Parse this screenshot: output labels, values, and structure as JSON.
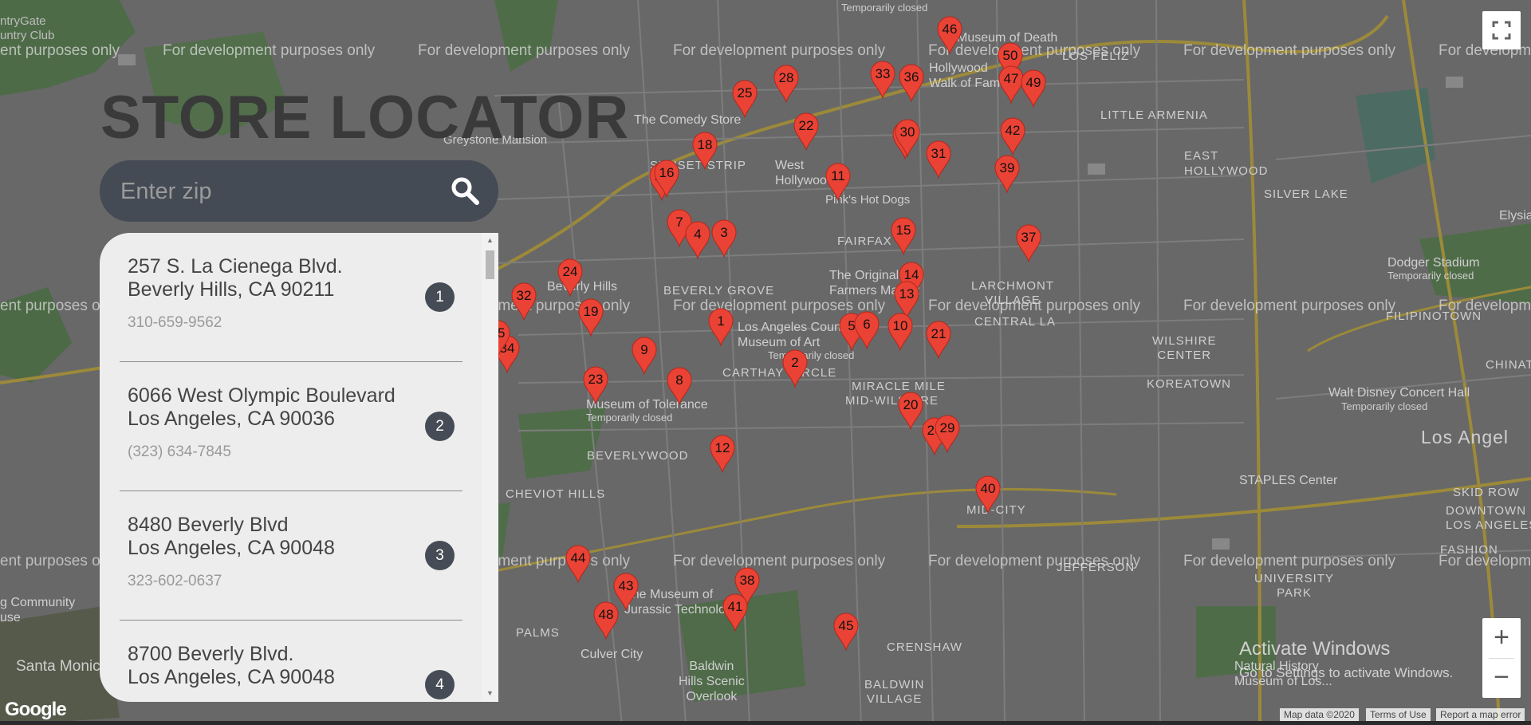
{
  "watermark": "For development purposes only",
  "watermark_prefix": "ent purposes only",
  "watermark_suffix": "For developm",
  "title": "STORE LOCATOR",
  "search": {
    "placeholder": "Enter zip",
    "icon": "search-icon"
  },
  "stores": [
    {
      "line1": "257 S. La Cienega Blvd.",
      "line2": "Beverly Hills, CA 90211",
      "phone": "310-659-9562",
      "number": "1"
    },
    {
      "line1": "6066 West Olympic Boulevard",
      "line2": "Los Angeles, CA 90036",
      "phone": "(323) 634-7845",
      "number": "2"
    },
    {
      "line1": "8480 Beverly Blvd",
      "line2": "Los Angeles, CA 90048",
      "phone": "323-602-0637",
      "number": "3"
    },
    {
      "line1": "8700 Beverly Blvd.",
      "line2": "Los Angeles, CA 90048",
      "phone": "",
      "number": "4"
    }
  ],
  "markers": [
    "46",
    "50",
    "47",
    "49",
    "33",
    "36",
    "25",
    "28",
    "22",
    "18",
    "27",
    "31",
    "42",
    "39",
    "17",
    "11",
    "7",
    "4",
    "3",
    "15",
    "37",
    "24",
    "32",
    "19",
    "14",
    "13",
    "1",
    "5",
    "6",
    "10",
    "21",
    "34",
    "9",
    "8",
    "23",
    "2",
    "20",
    "26",
    "29",
    "12",
    "40",
    "44",
    "43",
    "38",
    "41",
    "48",
    "45",
    "16",
    "35",
    "30"
  ],
  "map_labels": {
    "country_club": "ntryGate\nuntry Club",
    "greystone": "Greystone Mansion",
    "comedy_store": "The Comedy Store",
    "sunset_strip": "SUNSET STRIP",
    "west_hollywood": "West\nHollywood",
    "pinks": "Pink's Hot Dogs",
    "fairfax": "FAIRFAX",
    "farmers": "The Original\nFarmers Market",
    "beverly_grove": "BEVERLY GROVE",
    "beverly_hills": "Beverly Hills",
    "lacma": "Los Angeles County\nMuseum of Art",
    "carthay": "CARTHAY CIRCLE",
    "miracle_mile": "MIRACLE MILE",
    "mid_wilshire": "MID-WILSHIRE",
    "tolerance": "Museum of Tolerance",
    "temp_closed": "Temporarily closed",
    "beverlywood": "BEVERLYWOOD",
    "cheviot": "CHEVIOT HILLS",
    "mid_city": "MID-CITY",
    "palms": "PALMS",
    "culver": "Culver City",
    "jurassic": "The Museum of\nJurassic Technology",
    "baldwin": "Baldwin\nHills Scenic\nOverlook",
    "crenshaw": "CRENSHAW",
    "baldwin_village": "BALDWIN\nVILLAGE",
    "santa_monica": "Santa Monic",
    "hollywood": "Hollywood\nWalk of Fame",
    "museum_death": "Museum of Death",
    "los_feliz": "LOS FELIZ",
    "little_armenia": "LITTLE ARMENIA",
    "east_hollywood": "EAST\nHOLLYWOOD",
    "silver_lake": "SILVER LAKE",
    "dodger": "Dodger Stadium",
    "larchmont": "LARCHMONT\nVILLAGE",
    "filipinotown": "FILIPINOTOWN",
    "central_la": "CENTRAL LA",
    "wilshire_center": "WILSHIRE\nCENTER",
    "koreatown": "KOREATOWN",
    "disney": "Walt Disney Concert Hall",
    "los_angeles": "Los Angel",
    "staples": "STAPLES Center",
    "downtown": "DOWNTOWN\nLOS ANGELES",
    "skid_row": "SKID ROW",
    "jefferson": "JEFFERSON",
    "university_park": "UNIVERSITY\nPARK",
    "natural_history": "Natural History\nMuseum of Los...",
    "chinatown": "CHINAT",
    "elysia": "Elysia",
    "gardens": "g Community\nuse",
    "fashion": "FASHION"
  },
  "fullscreen_icon": "fullscreen-icon",
  "zoom": {
    "in": "+",
    "out": "−"
  },
  "activate": {
    "line1": "Activate Windows",
    "line2": "Go to Settings to activate Windows."
  },
  "attribution": {
    "map_data": "Map data ©2020",
    "terms": "Terms of Use",
    "report": "Report a map error"
  },
  "google_logo": "Google"
}
